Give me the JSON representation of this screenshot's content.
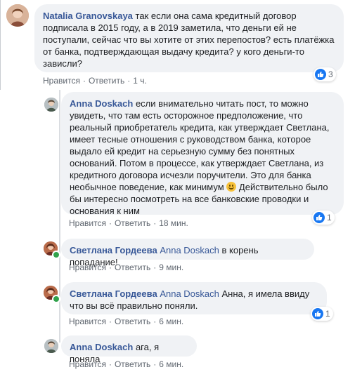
{
  "actions": {
    "like": "Нравится",
    "reply": "Ответить",
    "separator": "·"
  },
  "comments": [
    {
      "author": "Natalia Granovskaya",
      "text": "так если она сама кредитный договор подписала в 2015 году, а в 2019 заметила, что деньги ей не поступали, сейчас что вы хотите от этих перепостов? есть платёжка от банка, подтверждающая выдачу кредита? у кого деньги-то зависли?",
      "time": "1 ч.",
      "reactions": 3
    },
    {
      "author": "Anna Doskach",
      "text_before": "если внимательно читать пост, то можно увидеть, что там есть осторожное предположение, что реальный приобретатель кредита, как утверждает Светлана, имеет тесные отношения с руководством банка, которое выдало ей кредит на серьезную сумму без понятных оснований. Потом в процессе, как утверждает Светлана, из кредитного договора исчезли поручители. Это для банка необычное поведение, как минимум",
      "text_after": "Действительно было бы интересно посмотреть на все банковские проводки и основания к ним",
      "emoji": "smile-emoji",
      "time": "18 мин.",
      "reactions": 1
    },
    {
      "author": "Светлана Гордеева",
      "mention": "Anna Doskach",
      "text": "в корень попадание!",
      "time": "9 мин."
    },
    {
      "author": "Светлана Гордеева",
      "mention": "Anna Doskach",
      "text": "Анна, я имела ввиду что вы всё правильно поняли.",
      "time": "6 мин.",
      "reactions": 1
    },
    {
      "author": "Anna Doskach",
      "text": "ага, я поняла",
      "time": "6 мин."
    }
  ],
  "colors": {
    "link": "#385898",
    "bubble": "#f0f2f5",
    "like": "#1877f2",
    "online": "#31a24c"
  }
}
